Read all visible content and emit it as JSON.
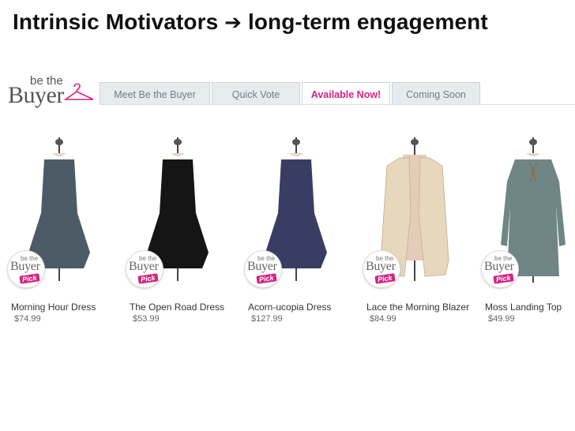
{
  "slide": {
    "title_left": "Intrinsic Motivators",
    "title_arrow": "➔",
    "title_right": "long-term engagement"
  },
  "logo": {
    "small": "be the",
    "big": "Buyer"
  },
  "tabs": [
    {
      "label": "Meet Be the Buyer",
      "active": false
    },
    {
      "label": "Quick Vote",
      "active": false
    },
    {
      "label": "Available Now!",
      "active": true
    },
    {
      "label": "Coming Soon",
      "active": false
    }
  ],
  "badge": {
    "small": "be the",
    "big": "Buyer",
    "pick": "Pick"
  },
  "products": [
    {
      "name": "Morning Hour Dress",
      "price": "$74.99",
      "color": "#4c5b66",
      "icon": "dress"
    },
    {
      "name": "The Open Road Dress",
      "price": "$53.99",
      "color": "#151515",
      "icon": "dress"
    },
    {
      "name": "Acorn-ucopia Dress",
      "price": "$127.99",
      "color": "#3a3d63",
      "icon": "dress"
    },
    {
      "name": "Lace the Morning Blazer",
      "price": "$84.99",
      "color": "#e6d7bd",
      "icon": "blazer"
    },
    {
      "name": "Moss Landing Top",
      "price": "$49.99",
      "color": "#6f8586",
      "icon": "top"
    }
  ]
}
